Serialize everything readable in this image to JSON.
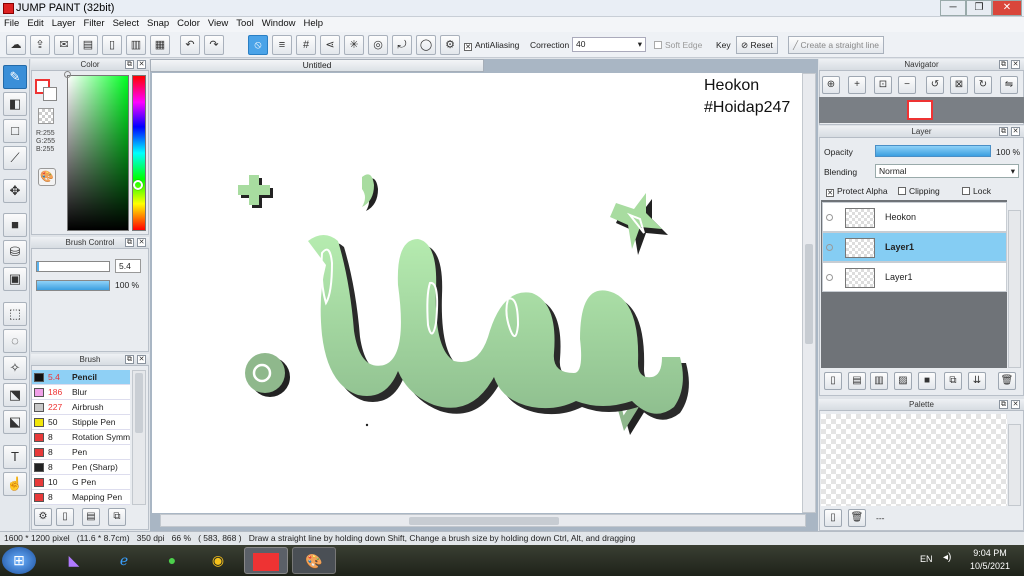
{
  "window": {
    "title": "JUMP PAINT (32bit)",
    "minimize": "─",
    "maximize": "❐",
    "close": "✕"
  },
  "menu": [
    "File",
    "Edit",
    "Layer",
    "Filter",
    "Select",
    "Snap",
    "Color",
    "View",
    "Tool",
    "Window",
    "Help"
  ],
  "toolbar": {
    "antialiasing_label": "AntiAliasing",
    "correction_label": "Correction",
    "correction_value": "40",
    "soft_edge_label": "Soft Edge",
    "key_label": "Key",
    "reset_label": "Reset",
    "straight_line_label": "Create a straight line"
  },
  "color_panel": {
    "title": "Color",
    "r": "R:255",
    "g": "G:255",
    "b": "B:255"
  },
  "brush_control": {
    "title": "Brush Control",
    "size": "5.4",
    "opacity": "100 %"
  },
  "brush_panel": {
    "title": "Brush",
    "items": [
      {
        "size": "5.4",
        "name": "Pencil",
        "color": "#111111"
      },
      {
        "size": "186",
        "name": "Blur",
        "color": "#f0a0e8"
      },
      {
        "size": "227",
        "name": "Airbrush",
        "color": "#c8c8c8"
      },
      {
        "size": "50",
        "name": "Stipple Pen",
        "color": "#f2e60a"
      },
      {
        "size": "8",
        "name": "Rotation Symm",
        "color": "#e83a3a"
      },
      {
        "size": "8",
        "name": "Pen",
        "color": "#e83a3a"
      },
      {
        "size": "8",
        "name": "Pen (Sharp)",
        "color": "#222222"
      },
      {
        "size": "10",
        "name": "G Pen",
        "color": "#e83a3a"
      },
      {
        "size": "8",
        "name": "Mapping Pen",
        "color": "#e83a3a"
      }
    ]
  },
  "document": {
    "tab": "Untitled",
    "text_line1": "Heokon",
    "text_line2": "#Hoidap247"
  },
  "navigator": {
    "title": "Navigator"
  },
  "layer_panel": {
    "title": "Layer",
    "opacity_label": "Opacity",
    "opacity_value": "100 %",
    "blending_label": "Blending",
    "blending_value": "Normal",
    "protect_alpha": "Protect Alpha",
    "clipping": "Clipping",
    "lock": "Lock",
    "layers": [
      {
        "name": "Heokon",
        "selected": false
      },
      {
        "name": "Layer1",
        "selected": true
      },
      {
        "name": "Layer1",
        "selected": false
      }
    ]
  },
  "palette": {
    "title": "Palette",
    "dash": "---"
  },
  "status": {
    "size": "1600 * 1200 pixel",
    "cm": "(11.6 * 8.7cm)",
    "dpi": "350 dpi",
    "zoom": "66 %",
    "coords": "( 583, 868 )",
    "hint": "Draw a straight line by holding down Shift, Change a brush size by holding down Ctrl, Alt, and dragging"
  },
  "taskbar": {
    "lang": "EN",
    "time": "9:04 PM",
    "date": "10/5/2021"
  },
  "colors": {
    "accent": "#3a8fd8",
    "selected_row": "#85cdf3",
    "art_green": "#a8dca0"
  }
}
